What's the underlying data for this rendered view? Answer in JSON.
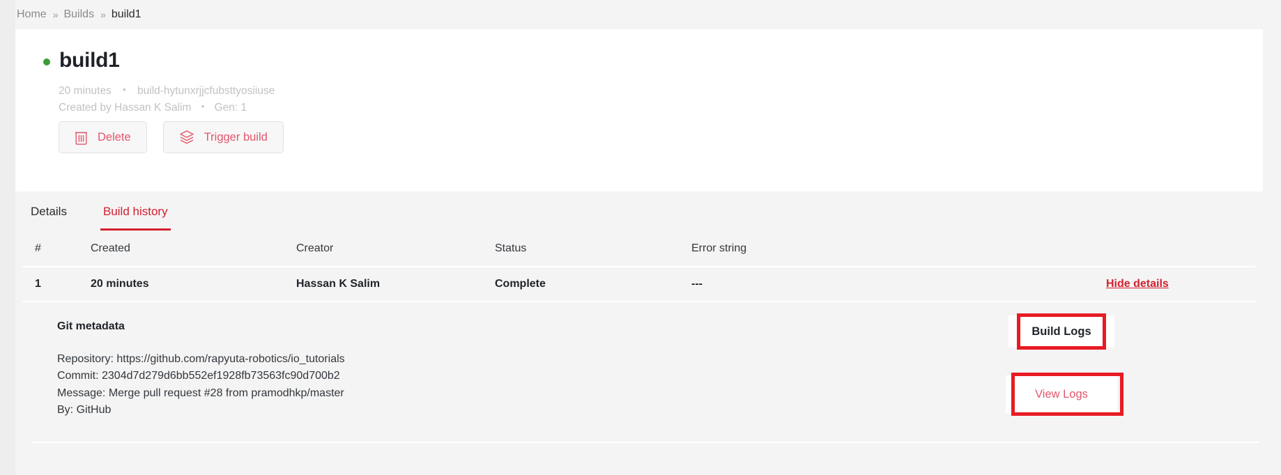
{
  "breadcrumb": {
    "separator": "»",
    "items": [
      {
        "label": "Home"
      },
      {
        "label": "Builds"
      },
      {
        "label": "build1"
      }
    ]
  },
  "header": {
    "status_color": "#3c9c35",
    "title": "build1",
    "age": "20 minutes",
    "build_id": "build-hytunxrjjcfubsttyosiiuse",
    "created_by": "Created by Hassan K Salim",
    "generation": "Gen: 1",
    "separator": "•",
    "delete_label": "Delete",
    "trigger_label": "Trigger build",
    "accent_color": "#e2566b"
  },
  "tabs": [
    {
      "label": "Details",
      "active": false
    },
    {
      "label": "Build history",
      "active": true
    }
  ],
  "table": {
    "headers": {
      "num": "#",
      "created": "Created",
      "creator": "Creator",
      "status": "Status",
      "error": "Error string",
      "action": ""
    },
    "row": {
      "num": "1",
      "created": "20 minutes",
      "creator": "Hassan K Salim",
      "status": "Complete",
      "error": "---",
      "toggle_label": "Hide details"
    }
  },
  "detail": {
    "title": "Git metadata",
    "repository": "Repository: https://github.com/rapyuta-robotics/io_tutorials",
    "commit": "Commit: 2304d7d279d6bb552ef1928fb73563fc90d700b2",
    "message": "Message: Merge pull request #28 from pramodhkp/master",
    "by": "By: GitHub",
    "build_logs_label": "Build Logs",
    "view_logs_label": "View Logs"
  },
  "annotations": {
    "color": "#e81b23",
    "boxes": [
      {
        "target": "build-logs-label"
      },
      {
        "target": "view-logs-button"
      }
    ]
  }
}
